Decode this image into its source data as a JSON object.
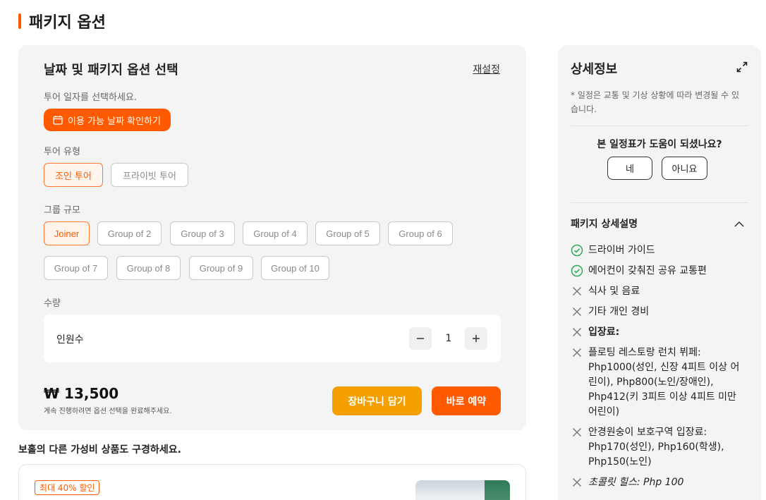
{
  "section": {
    "title": "패키지 옵션"
  },
  "options": {
    "title": "날짜 및 패키지 옵션 선택",
    "reset_label": "재설정",
    "date_prompt": "투어 일자를 선택하세요.",
    "date_button": "이용 가능 날짜 확인하기",
    "tour_type_label": "투어 유형",
    "tour_types": [
      "조인 투어",
      "프라이빗 투어"
    ],
    "tour_type_selected": "조인 투어",
    "group_label": "그룹 규모",
    "groups": [
      "Joiner",
      "Group of 2",
      "Group of 3",
      "Group of 4",
      "Group of 5",
      "Group of 6",
      "Group of 7",
      "Group of 8",
      "Group of 9",
      "Group of 10"
    ],
    "group_selected": "Joiner",
    "quantity_label": "수량",
    "quantity_row_label": "인원수",
    "quantity_value": "1",
    "price": "₩ 13,500",
    "price_note": "계속 진행하려면 옵션 선택을 완료해주세요.",
    "cart_button": "장바구니 담기",
    "buy_button": "바로 예약"
  },
  "more": {
    "title": "보홀의 다른 가성비 상품도 구경하세요.",
    "badge": "최대 40% 할인"
  },
  "details": {
    "title": "상세정보",
    "note": "* 일정은 교통 및 기상 상황에 따라 변경될 수 있습니다.",
    "helpful_question": "본 일정표가 도움이 되셨나요?",
    "yes_label": "네",
    "no_label": "아니요",
    "package_title": "패키지 상세설명",
    "items": [
      {
        "text": "드라이버 가이드",
        "included": true,
        "style": "normal"
      },
      {
        "text": "에어컨이 갖춰진 공유 교통편",
        "included": true,
        "style": "normal"
      },
      {
        "text": "식사 및 음료",
        "included": false,
        "style": "normal"
      },
      {
        "text": "기타 개인 경비",
        "included": false,
        "style": "normal"
      },
      {
        "text": "입장료:",
        "included": false,
        "style": "bold"
      },
      {
        "text": "플로팅 레스토랑 런치 뷔페: Php1000(성인, 신장 4피트 이상 어린이), Php800(노인/장애인), Php412(키 3피트 이상 4피트 미만 어린이)",
        "included": false,
        "style": "normal"
      },
      {
        "text": "안경원숭이 보호구역 입장료: Php170(성인), Php160(학생), Php150(노인)",
        "included": false,
        "style": "normal"
      },
      {
        "text": "초콜릿 힐스: Php 100",
        "included": false,
        "style": "italic"
      }
    ]
  },
  "colors": {
    "accent": "#ff5a00",
    "cart": "#f5a000",
    "panel_bg": "#f4f4f4",
    "check": "#2eaa5c"
  }
}
